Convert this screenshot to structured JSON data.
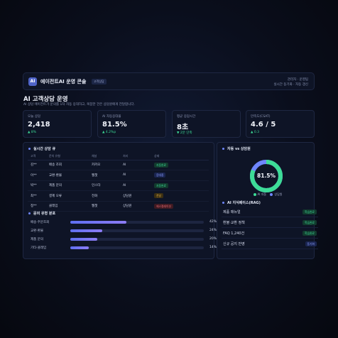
{
  "header": {
    "logo_text": "AI",
    "title": "에이전트AI 운영 콘솔",
    "badge": "고객상담",
    "meta_line1": "관리자 · 운영팀",
    "meta_line2": "실시간 동기화 · 자동 갱신"
  },
  "page": {
    "title": "AI 고객상담 운영",
    "subtitle": "AI 상담 에이전트가 문의를 1차 자동 응대하고, 복잡한 건은 상담원에게 전달합니다."
  },
  "kpis": [
    {
      "label": "오늘 상담",
      "value": "2,418",
      "delta": "▲ 8%"
    },
    {
      "label": "AI 자동응대율",
      "value": "81.5%",
      "delta": "▲ 4.2%p"
    },
    {
      "label": "평균 응답시간",
      "value": "8초",
      "delta": "▼ 2분 단축"
    },
    {
      "label": "만족도(CSAT)",
      "value": "4.6 / 5",
      "delta": "▲ 0.3"
    }
  ],
  "live": {
    "title": "실시간 상담 큐",
    "columns": [
      "고객",
      "문의 유형",
      "채널",
      "처리",
      "상태"
    ],
    "rows": [
      {
        "customer": "김**",
        "type": "배송 조회",
        "channel": "카카오",
        "handler": "AI",
        "status": "자동완료",
        "status_color": "green"
      },
      {
        "customer": "이**",
        "type": "교환·환불",
        "channel": "웹챗",
        "handler": "AI",
        "status": "응대중",
        "status_color": "blue"
      },
      {
        "customer": "박**",
        "type": "제품 문의",
        "channel": "인스타",
        "handler": "AI",
        "status": "자동완료",
        "status_color": "green"
      },
      {
        "customer": "최**",
        "type": "결제 오류",
        "channel": "전화",
        "handler": "상담원",
        "status": "전달",
        "status_color": "amber"
      },
      {
        "customer": "정**",
        "type": "클레임",
        "channel": "웹챗",
        "handler": "상담원",
        "status": "에스컬레이션",
        "status_color": "red"
      }
    ]
  },
  "inquiry": {
    "title": "문의 유형 분포",
    "items": [
      {
        "label": "배송·주문조회",
        "pct": 42,
        "pct_label": "42%"
      },
      {
        "label": "교환·환불",
        "pct": 24,
        "pct_label": "24%"
      },
      {
        "label": "제품 문의",
        "pct": 20,
        "pct_label": "20%"
      },
      {
        "label": "기타·클레임",
        "pct": 14,
        "pct_label": "14%"
      }
    ]
  },
  "ratio": {
    "title": "자동 vs 상담원",
    "center": "81.5%",
    "ai_share": 81.5,
    "legend_ai": "AI 자동",
    "legend_agent": "상담원",
    "ai_color": "#3ddc97",
    "agent_color": "#6f86ff"
  },
  "kb": {
    "title": "AI 지식베이스(RAG)",
    "items": [
      {
        "name": "제품 매뉴얼",
        "tag": "학습완료"
      },
      {
        "name": "환불·교환 정책",
        "tag": "학습완료"
      },
      {
        "name": "FAQ 1,240건",
        "tag": "학습완료"
      },
      {
        "name": "신규 공지 반영",
        "tag": "동기화"
      }
    ]
  },
  "colors": {
    "green": "#3ddc97",
    "blue": "#6f86ff",
    "amber": "#e6b34a",
    "red": "#ef6b73"
  }
}
